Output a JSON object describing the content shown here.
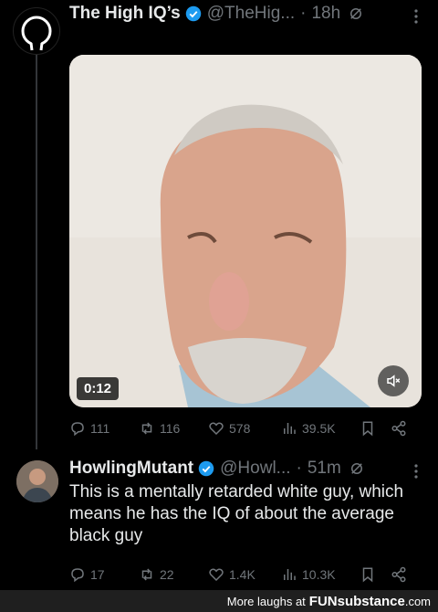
{
  "tweet1": {
    "name": "The High IQ’s",
    "handle": "@TheHig...",
    "dot": "·",
    "time": "18h",
    "video_duration": "0:12",
    "replies": "111",
    "retweets": "116",
    "likes": "578",
    "views": "39.5K"
  },
  "tweet2": {
    "name": "HowlingMutant",
    "handle": "@Howl...",
    "dot": "·",
    "time": "51m",
    "text": "This is a mentally retarded white guy, which means he has the IQ of about the average black guy",
    "replies": "17",
    "retweets": "22",
    "likes": "1.4K",
    "views": "10.3K"
  },
  "footer": {
    "more_laughs": "More laughs at",
    "brand": "FUNsubstance",
    "domain": ".com"
  },
  "colors": {
    "background": "#000000",
    "text": "#e7e9ea",
    "muted": "#71767b",
    "verified": "#1d9bf0"
  }
}
